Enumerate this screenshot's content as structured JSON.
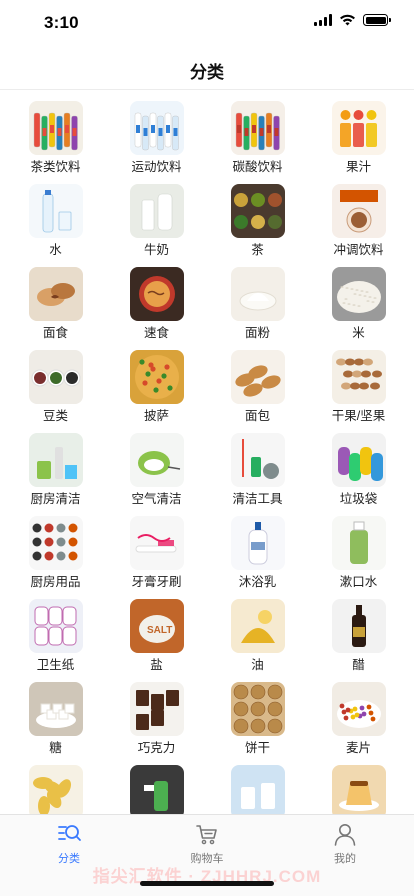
{
  "status": {
    "time": "3:10"
  },
  "nav": {
    "title": "分类"
  },
  "categories": [
    {
      "label": "茶类饮料",
      "icon": "tea-drinks-icon",
      "bg": "#f3efe6",
      "accent": "#e74c3c"
    },
    {
      "label": "运动饮料",
      "icon": "sports-drink-icon",
      "bg": "#eef5fb",
      "accent": "#2f7fd6"
    },
    {
      "label": "碳酸饮料",
      "icon": "soda-icon",
      "bg": "#f5efe8",
      "accent": "#c0392b"
    },
    {
      "label": "果汁",
      "icon": "juice-icon",
      "bg": "#fbf4ea",
      "accent": "#f39c12"
    },
    {
      "label": "水",
      "icon": "water-bottle-icon",
      "bg": "#f4f8fb",
      "accent": "#4aa3df"
    },
    {
      "label": "牛奶",
      "icon": "milk-icon",
      "bg": "#e9ece6",
      "accent": "#ffffff"
    },
    {
      "label": "茶",
      "icon": "tea-leaves-icon",
      "bg": "#4a3a2e",
      "accent": "#8a9a3a"
    },
    {
      "label": "冲调饮料",
      "icon": "instant-drink-icon",
      "bg": "#f6eee8",
      "accent": "#d35400"
    },
    {
      "label": "面食",
      "icon": "pastry-icon",
      "bg": "#e8dccb",
      "accent": "#b06a3a"
    },
    {
      "label": "速食",
      "icon": "instant-noodle-icon",
      "bg": "#3b2a22",
      "accent": "#e8a04a"
    },
    {
      "label": "面粉",
      "icon": "flour-icon",
      "bg": "#f3efe8",
      "accent": "#fbfaf6"
    },
    {
      "label": "米",
      "icon": "rice-icon",
      "bg": "#9a9a9a",
      "accent": "#f4f1ea"
    },
    {
      "label": "豆类",
      "icon": "beans-icon",
      "bg": "#efece6",
      "accent": "#7a2e2e"
    },
    {
      "label": "披萨",
      "icon": "pizza-icon",
      "bg": "#d9a23a",
      "accent": "#d64a2a"
    },
    {
      "label": "面包",
      "icon": "bread-icon",
      "bg": "#f6f1ea",
      "accent": "#c98a45"
    },
    {
      "label": "干果/坚果",
      "icon": "nuts-icon",
      "bg": "#f4efe6",
      "accent": "#a86a3a"
    },
    {
      "label": "厨房清洁",
      "icon": "kitchen-cleaning-icon",
      "bg": "#e8efe8",
      "accent": "#8bc34a"
    },
    {
      "label": "空气清洁",
      "icon": "air-purifier-icon",
      "bg": "#f4f6f4",
      "accent": "#8bc34a"
    },
    {
      "label": "清洁工具",
      "icon": "cleaning-tools-icon",
      "bg": "#f6f6f6",
      "accent": "#e74c3c"
    },
    {
      "label": "垃圾袋",
      "icon": "trash-bag-icon",
      "bg": "#f2f2f2",
      "accent": "#9b59b6"
    },
    {
      "label": "厨房用品",
      "icon": "kitchenware-icon",
      "bg": "#f7f7f7",
      "accent": "#333333"
    },
    {
      "label": "牙膏牙刷",
      "icon": "toothbrush-icon",
      "bg": "#f7f7f7",
      "accent": "#e91e63"
    },
    {
      "label": "沐浴乳",
      "icon": "body-wash-icon",
      "bg": "#f7f8fb",
      "accent": "#1e5aa8"
    },
    {
      "label": "漱口水",
      "icon": "mouthwash-icon",
      "bg": "#f7f8f5",
      "accent": "#7cb342"
    },
    {
      "label": "卫生纸",
      "icon": "toilet-paper-icon",
      "bg": "#eef0f7",
      "accent": "#c06bb0"
    },
    {
      "label": "盐",
      "icon": "salt-icon",
      "bg": "#c1662a",
      "accent": "#f2f0ea"
    },
    {
      "label": "油",
      "icon": "oil-icon",
      "bg": "#f6ead0",
      "accent": "#e6b325"
    },
    {
      "label": "醋",
      "icon": "vinegar-icon",
      "bg": "#f2f2f2",
      "accent": "#2b1a12"
    },
    {
      "label": "糖",
      "icon": "sugar-icon",
      "bg": "#cfc6b8",
      "accent": "#ffffff"
    },
    {
      "label": "巧克力",
      "icon": "chocolate-icon",
      "bg": "#f4f2ee",
      "accent": "#4b2a1a"
    },
    {
      "label": "饼干",
      "icon": "biscuits-icon",
      "bg": "#d9b98a",
      "accent": "#b98a4a"
    },
    {
      "label": "麦片",
      "icon": "cereal-icon",
      "bg": "#f1ece4",
      "accent": "#c0392b"
    },
    {
      "label": "",
      "icon": "chips-icon",
      "bg": "#f6f1e4",
      "accent": "#e9c047"
    },
    {
      "label": "",
      "icon": "cleaner-spray-icon",
      "bg": "#3a3a3a",
      "accent": "#4caf50"
    },
    {
      "label": "",
      "icon": "yogurt-icon",
      "bg": "#cfe3f3",
      "accent": "#ffffff"
    },
    {
      "label": "",
      "icon": "pudding-icon",
      "bg": "#f1d9b0",
      "accent": "#e59b2a"
    }
  ],
  "tabs": [
    {
      "label": "分类",
      "icon": "category-search-icon",
      "active": true
    },
    {
      "label": "购物车",
      "icon": "cart-icon",
      "active": false
    },
    {
      "label": "我的",
      "icon": "user-icon",
      "active": false
    }
  ],
  "watermark": "指尖汇软件 · ZJHHRJ.COM"
}
